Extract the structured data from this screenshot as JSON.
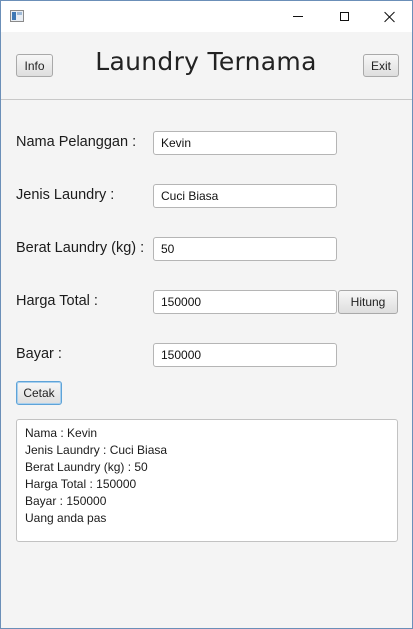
{
  "window": {
    "title_bar": {
      "icon": "app-window-icon",
      "controls": [
        "minimize-icon",
        "maximize-icon",
        "close-icon"
      ]
    }
  },
  "header": {
    "info_label": "Info",
    "title": "Laundry Ternama",
    "exit_label": "Exit"
  },
  "form": {
    "nama_label": "Nama Pelanggan :",
    "nama_value": "Kevin",
    "jenis_label": "Jenis Laundry :",
    "jenis_value": "Cuci Biasa",
    "berat_label": "Berat Laundry (kg) :",
    "berat_value": "50",
    "harga_label": "Harga Total :",
    "harga_value": "150000",
    "hitung_label": "Hitung",
    "bayar_label": "Bayar :",
    "bayar_value": "150000",
    "cetak_label": "Cetak"
  },
  "output": {
    "lines": [
      "Nama : Kevin",
      "Jenis Laundry : Cuci Biasa",
      "Berat Laundry (kg) : 50",
      "Harga Total : 150000",
      "Bayar : 150000",
      "Uang anda pas"
    ]
  }
}
